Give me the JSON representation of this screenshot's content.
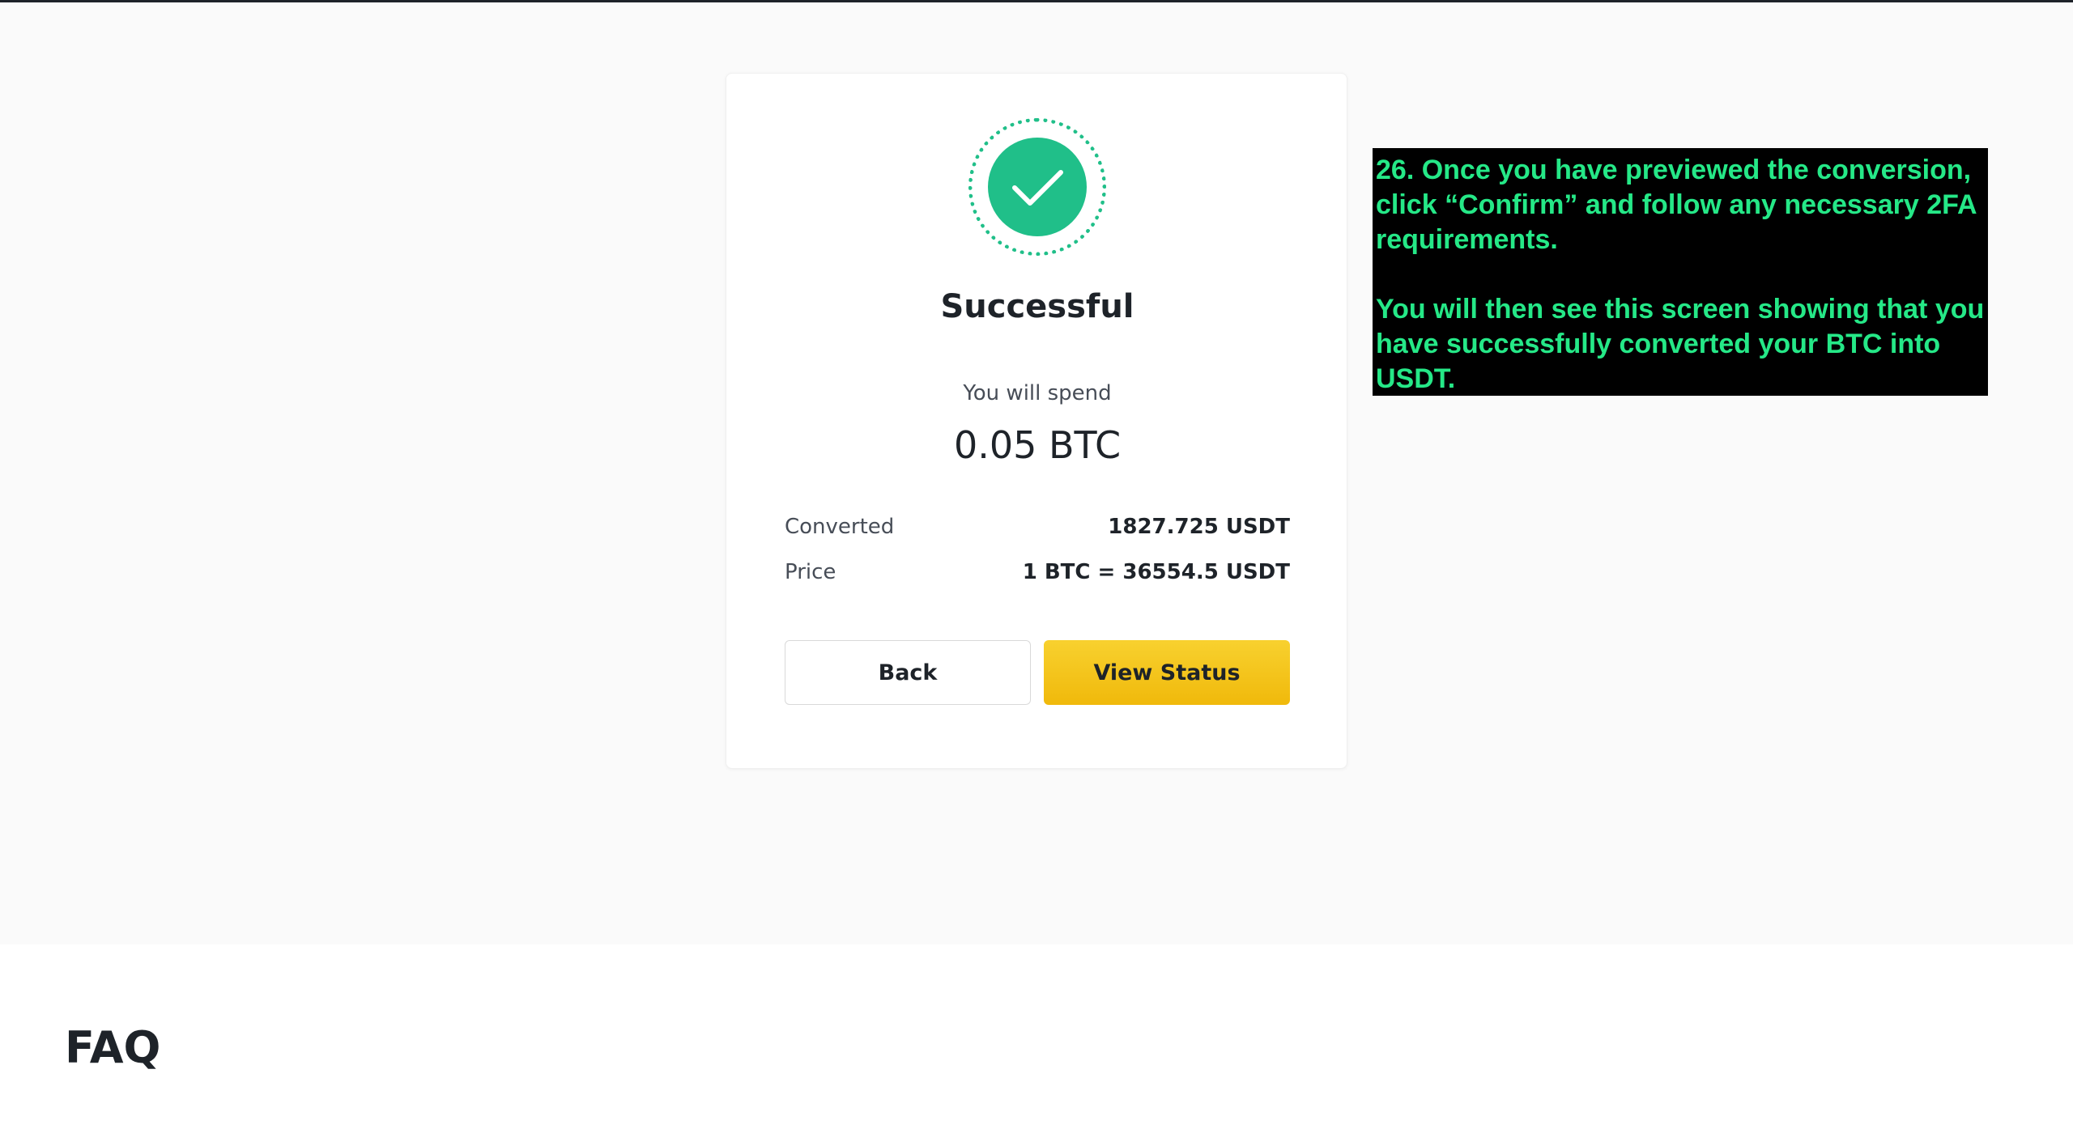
{
  "result": {
    "status_title": "Successful",
    "spend_label": "You will spend",
    "spend_amount": "0.05 BTC",
    "details": [
      {
        "label": "Converted",
        "value": "1827.725 USDT"
      },
      {
        "label": "Price",
        "value": "1 BTC = 36554.5 USDT"
      }
    ],
    "back_label": "Back",
    "view_status_label": "View Status",
    "icon": "checkmark-icon"
  },
  "annotation": {
    "paragraph1": "26. Once you have previewed the conversion, click “Confirm” and follow any necessary 2FA requirements.",
    "paragraph2": "You will then see this screen showing that you have successfully converted your BTC into USDT."
  },
  "faq": {
    "title": "FAQ"
  },
  "colors": {
    "success": "#20bf89",
    "primary_button": "#f0b90b",
    "annotation_text": "#25e887",
    "annotation_bg": "#000000"
  }
}
